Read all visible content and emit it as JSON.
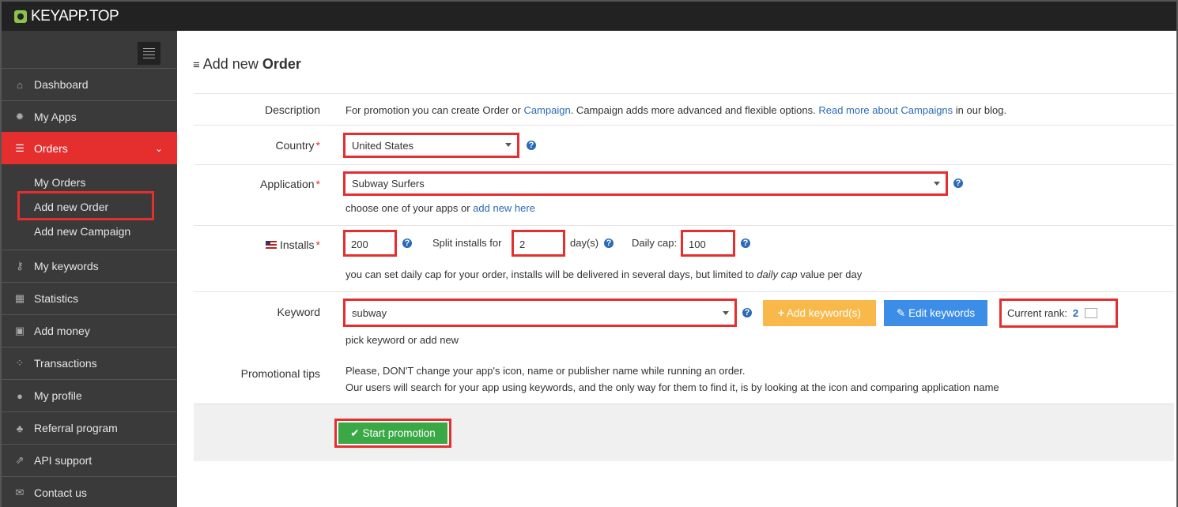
{
  "brand": {
    "name": "KEYAPP.TOP"
  },
  "sidebar": {
    "items": [
      {
        "label": "Dashboard",
        "icon": "home-icon"
      },
      {
        "label": "My Apps",
        "icon": "gear-icon"
      },
      {
        "label": "Orders",
        "icon": "list-icon"
      },
      {
        "label": "My keywords",
        "icon": "key-icon"
      },
      {
        "label": "Statistics",
        "icon": "table-icon"
      },
      {
        "label": "Add money",
        "icon": "money-icon"
      },
      {
        "label": "Transactions",
        "icon": "spinner-icon"
      },
      {
        "label": "My profile",
        "icon": "user-icon"
      },
      {
        "label": "Referral program",
        "icon": "sitemap-icon"
      },
      {
        "label": "API support",
        "icon": "external-link-icon"
      },
      {
        "label": "Contact us",
        "icon": "envelope-icon"
      }
    ],
    "sub_items": [
      "My Orders",
      "Add new Order",
      "Add new Campaign"
    ]
  },
  "page": {
    "title_prefix": "Add new ",
    "title_bold": "Order"
  },
  "form": {
    "description": {
      "label": "Description",
      "text1": "For promotion you can create Order or ",
      "link1": "Campaign",
      "text2": ". Campaign adds more advanced and flexible options. ",
      "link2": "Read more about Campaigns",
      "text3": " in our blog."
    },
    "country": {
      "label": "Country",
      "value": "United States"
    },
    "application": {
      "label": "Application",
      "value": "Subway Surfers",
      "hint": "choose one of your apps or ",
      "hint_link": "add new here"
    },
    "installs": {
      "label": "Installs",
      "value": "200",
      "split_label": "Split installs for",
      "split_value": "2",
      "days_label": "day(s)",
      "cap_label": "Daily cap:",
      "cap_value": "100",
      "hint1": "you can set daily cap for your order, installs will be delivered in several days, but limited to ",
      "hint_em": "daily cap",
      "hint2": " value per day"
    },
    "keyword": {
      "label": "Keyword",
      "value": "subway",
      "add_button": "Add keyword(s)",
      "edit_button": "Edit keywords",
      "rank_label": "Current rank:",
      "rank_value": "2",
      "hint": "pick keyword or add new"
    },
    "tips": {
      "label": "Promotional tips",
      "line1": "Please, DON'T change your app's icon, name or publisher name while running an order.",
      "line2": "Our users will search for your app using keywords, and the only way for them to find it, is by looking at the icon and comparing application name"
    },
    "required_mark": "*",
    "help_glyph": "?",
    "submit": "Start promotion"
  },
  "colors": {
    "accent": "#e52e2e",
    "sidebar": "#3a3a3a",
    "topbar": "#222222",
    "link": "#2a6ab8",
    "success": "#3aa845",
    "warning": "#f9b84a",
    "info": "#3b8de8"
  }
}
